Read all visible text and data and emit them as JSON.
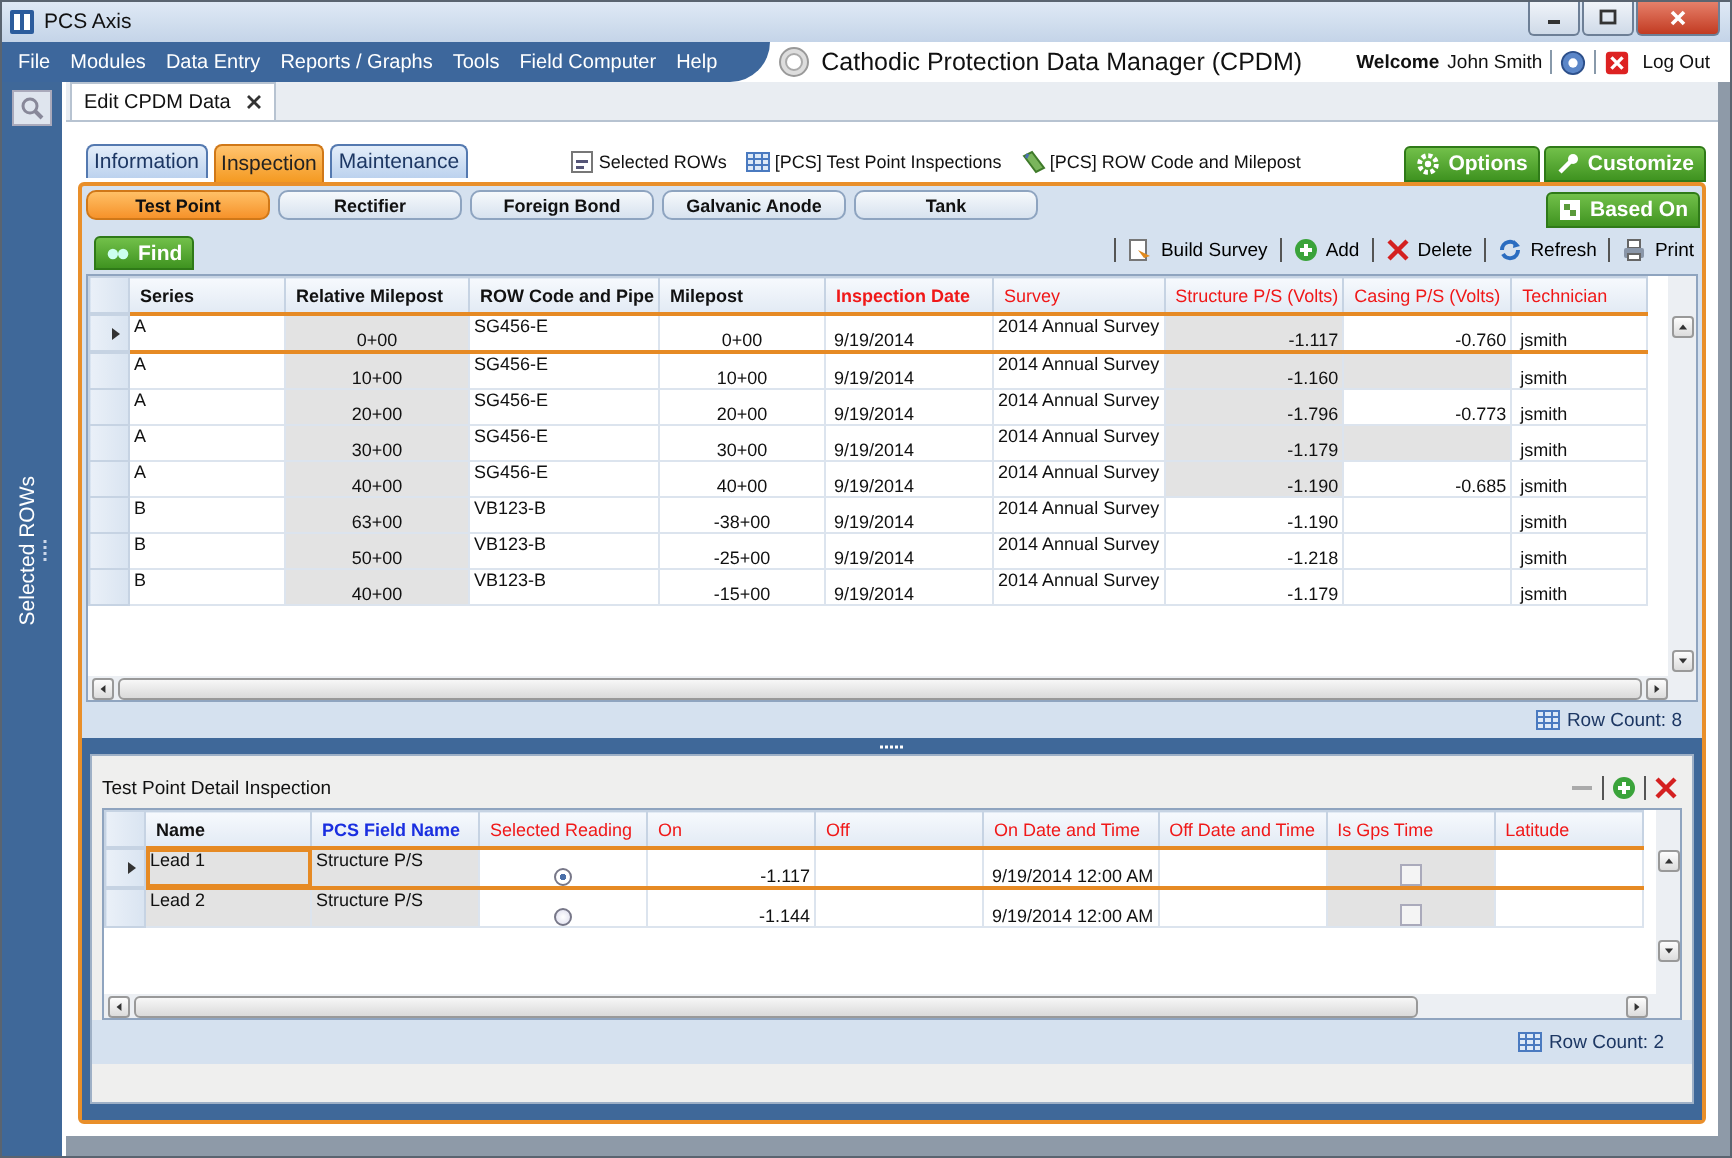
{
  "window": {
    "title": "PCS Axis"
  },
  "menu": [
    "File",
    "Modules",
    "Data Entry",
    "Reports / Graphs",
    "Tools",
    "Field Computer",
    "Help"
  ],
  "app_title": "Cathodic Protection Data Manager (CPDM)",
  "user": {
    "welcome": "Welcome",
    "name": "John Smith",
    "logout": "Log Out"
  },
  "sidebar": {
    "label": "Selected ROWs"
  },
  "document_tabs": [
    {
      "label": "Edit CPDM Data",
      "selected": true
    }
  ],
  "main_tabs": [
    {
      "label": "Information",
      "selected": false
    },
    {
      "label": "Inspection",
      "selected": true
    },
    {
      "label": "Maintenance",
      "selected": false
    }
  ],
  "links": [
    {
      "kind": "rows",
      "label": "Selected ROWs"
    },
    {
      "kind": "table",
      "label": "[PCS] Test Point Inspections"
    },
    {
      "kind": "milepost",
      "label": "[PCS] ROW Code and Milepost"
    }
  ],
  "header_buttons": [
    {
      "kind": "options",
      "label": "Options"
    },
    {
      "kind": "customize",
      "label": "Customize"
    }
  ],
  "sub_tabs": [
    {
      "label": "Test Point",
      "selected": true
    },
    {
      "label": "Rectifier",
      "selected": false
    },
    {
      "label": "Foreign Bond",
      "selected": false
    },
    {
      "label": "Galvanic Anode",
      "selected": false
    },
    {
      "label": "Tank",
      "selected": false
    }
  ],
  "based_on": "Based On",
  "find": "Find",
  "toolbar": [
    {
      "kind": "build",
      "label": "Build Survey"
    },
    {
      "kind": "add",
      "label": "Add"
    },
    {
      "kind": "delete",
      "label": "Delete"
    },
    {
      "kind": "refresh",
      "label": "Refresh"
    },
    {
      "kind": "print",
      "label": "Print"
    }
  ],
  "grid": {
    "columns": [
      {
        "label": "Series",
        "kind": "text",
        "editable": false,
        "required": true
      },
      {
        "label": "Relative Milepost",
        "kind": "station",
        "editable": false,
        "required": true
      },
      {
        "label": "ROW Code and Pipe",
        "kind": "text",
        "editable": false,
        "required": true
      },
      {
        "label": "Milepost",
        "kind": "station",
        "editable": false,
        "required": true
      },
      {
        "label": "Inspection Date",
        "kind": "date",
        "editable": true,
        "required": true
      },
      {
        "label": "Survey",
        "kind": "text",
        "editable": true,
        "required": false
      },
      {
        "label": "Structure P/S (Volts)",
        "kind": "number",
        "editable": true,
        "required": false
      },
      {
        "label": "Casing P/S (Volts)",
        "kind": "number",
        "editable": true,
        "required": false
      },
      {
        "label": "Technician",
        "kind": "date",
        "editable": true,
        "required": false
      }
    ],
    "rows": [
      {
        "selected": true,
        "cells": [
          {
            "text": "A",
            "shaded": false
          },
          {
            "text": "0+00",
            "shaded": true
          },
          {
            "text": "SG456-E",
            "shaded": false
          },
          {
            "text": "0+00",
            "shaded": false
          },
          {
            "text": "9/19/2014",
            "shaded": false
          },
          {
            "text": "2014 Annual Survey",
            "shaded": false
          },
          {
            "text": "-1.117",
            "shaded": true
          },
          {
            "text": "-0.760",
            "shaded": false
          },
          {
            "text": "jsmith",
            "shaded": false
          }
        ]
      },
      {
        "selected": false,
        "cells": [
          {
            "text": "A",
            "shaded": false
          },
          {
            "text": "10+00",
            "shaded": true
          },
          {
            "text": "SG456-E",
            "shaded": false
          },
          {
            "text": "10+00",
            "shaded": false
          },
          {
            "text": "9/19/2014",
            "shaded": false
          },
          {
            "text": "2014 Annual Survey",
            "shaded": false
          },
          {
            "text": "-1.160",
            "shaded": true
          },
          {
            "shaded": true
          },
          {
            "text": "jsmith",
            "shaded": false
          }
        ]
      },
      {
        "selected": false,
        "cells": [
          {
            "text": "A",
            "shaded": false
          },
          {
            "text": "20+00",
            "shaded": true
          },
          {
            "text": "SG456-E",
            "shaded": false
          },
          {
            "text": "20+00",
            "shaded": false
          },
          {
            "text": "9/19/2014",
            "shaded": false
          },
          {
            "text": "2014 Annual Survey",
            "shaded": false
          },
          {
            "text": "-1.796",
            "shaded": true
          },
          {
            "text": "-0.773",
            "shaded": false
          },
          {
            "text": "jsmith",
            "shaded": false
          }
        ]
      },
      {
        "selected": false,
        "cells": [
          {
            "text": "A",
            "shaded": false
          },
          {
            "text": "30+00",
            "shaded": true
          },
          {
            "text": "SG456-E",
            "shaded": false
          },
          {
            "text": "30+00",
            "shaded": false
          },
          {
            "text": "9/19/2014",
            "shaded": false
          },
          {
            "text": "2014 Annual Survey",
            "shaded": false
          },
          {
            "text": "-1.179",
            "shaded": true
          },
          {
            "shaded": true
          },
          {
            "text": "jsmith",
            "shaded": false
          }
        ]
      },
      {
        "selected": false,
        "cells": [
          {
            "text": "A",
            "shaded": false
          },
          {
            "text": "40+00",
            "shaded": true
          },
          {
            "text": "SG456-E",
            "shaded": false
          },
          {
            "text": "40+00",
            "shaded": false
          },
          {
            "text": "9/19/2014",
            "shaded": false
          },
          {
            "text": "2014 Annual Survey",
            "shaded": false
          },
          {
            "text": "-1.190",
            "shaded": true
          },
          {
            "text": "-0.685",
            "shaded": false
          },
          {
            "text": "jsmith",
            "shaded": false
          }
        ]
      },
      {
        "selected": false,
        "cells": [
          {
            "text": "B",
            "shaded": false
          },
          {
            "text": "63+00",
            "shaded": true
          },
          {
            "text": "VB123-B",
            "shaded": false
          },
          {
            "text": "-38+00",
            "shaded": false
          },
          {
            "text": "9/19/2014",
            "shaded": false
          },
          {
            "text": "2014 Annual Survey",
            "shaded": false
          },
          {
            "text": "-1.190",
            "shaded": false
          },
          {
            "shaded": false
          },
          {
            "text": "jsmith",
            "shaded": false
          }
        ]
      },
      {
        "selected": false,
        "cells": [
          {
            "text": "B",
            "shaded": false
          },
          {
            "text": "50+00",
            "shaded": true
          },
          {
            "text": "VB123-B",
            "shaded": false
          },
          {
            "text": "-25+00",
            "shaded": false
          },
          {
            "text": "9/19/2014",
            "shaded": false
          },
          {
            "text": "2014 Annual Survey",
            "shaded": false
          },
          {
            "text": "-1.218",
            "shaded": false
          },
          {
            "shaded": false
          },
          {
            "text": "jsmith",
            "shaded": false
          }
        ]
      },
      {
        "selected": false,
        "cells": [
          {
            "text": "B",
            "shaded": false
          },
          {
            "text": "40+00",
            "shaded": true
          },
          {
            "text": "VB123-B",
            "shaded": false
          },
          {
            "text": "-15+00",
            "shaded": false
          },
          {
            "text": "9/19/2014",
            "shaded": false
          },
          {
            "text": "2014 Annual Survey",
            "shaded": false
          },
          {
            "text": "-1.179",
            "shaded": false
          },
          {
            "shaded": false
          },
          {
            "text": "jsmith",
            "shaded": false
          }
        ]
      }
    ],
    "row_count": "Row Count:  8"
  },
  "detail": {
    "title": "Test Point Detail Inspection",
    "columns": [
      {
        "label": "Name",
        "kind": "text",
        "editable": false,
        "required": true
      },
      {
        "label": "PCS Field Name",
        "kind": "text",
        "linked": true,
        "required": true
      },
      {
        "label": "Selected Reading",
        "kind": "radio",
        "editable": true,
        "required": false
      },
      {
        "label": "On",
        "kind": "number",
        "editable": true,
        "required": false
      },
      {
        "label": "Off",
        "kind": "number",
        "editable": true,
        "required": false
      },
      {
        "label": "On Date and Time",
        "kind": "date",
        "editable": true,
        "required": false
      },
      {
        "label": "Off Date and Time",
        "kind": "date",
        "editable": true,
        "required": false
      },
      {
        "label": "Is Gps Time",
        "kind": "checkbox",
        "editable": true,
        "required": false
      },
      {
        "label": "Latitude",
        "kind": "text",
        "editable": true,
        "required": false
      }
    ],
    "rows": [
      {
        "selected": true,
        "cells": [
          {
            "text": "Lead 1",
            "shaded": true
          },
          {
            "text": "Structure P/S",
            "shaded": true
          },
          {
            "checked": true,
            "shaded": false
          },
          {
            "text": "-1.117",
            "shaded": false
          },
          {
            "shaded": false
          },
          {
            "text": "9/19/2014 12:00 AM",
            "shaded": false
          },
          {
            "shaded": false
          },
          {
            "checked": false,
            "shaded": true
          },
          {
            "shaded": false
          }
        ]
      },
      {
        "selected": false,
        "cells": [
          {
            "text": "Lead 2",
            "shaded": true
          },
          {
            "text": "Structure P/S",
            "shaded": true
          },
          {
            "checked": false,
            "shaded": false
          },
          {
            "text": "-1.144",
            "shaded": false
          },
          {
            "shaded": false
          },
          {
            "text": "9/19/2014 12:00 AM",
            "shaded": false
          },
          {
            "shaded": false
          },
          {
            "checked": false,
            "shaded": true
          },
          {
            "shaded": false
          }
        ]
      }
    ],
    "row_count": "Row Count:  2"
  }
}
